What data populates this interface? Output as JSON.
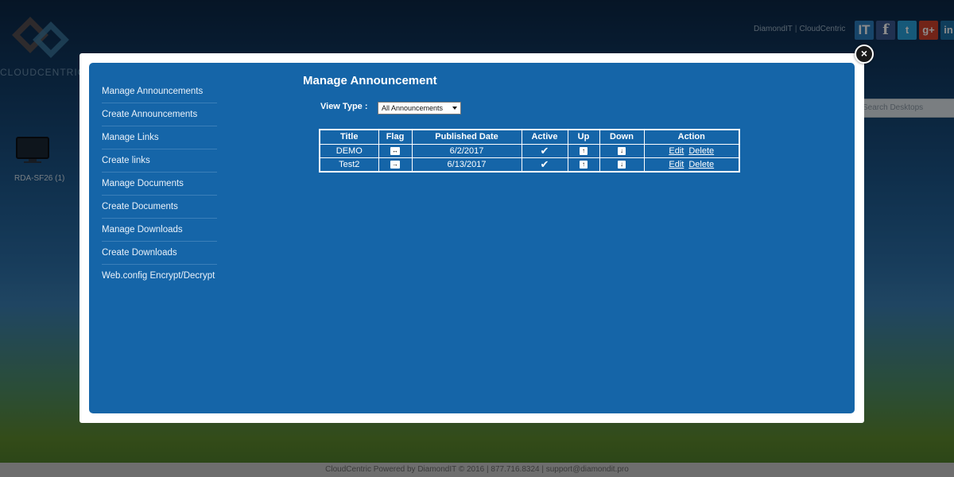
{
  "background": {
    "logo_text": "CLOUDCENTRIC",
    "header_links": [
      "DiamondIT",
      "CloudCentric"
    ],
    "header_sep": "|",
    "social_icons": [
      {
        "name": "it-icon",
        "glyph": "IT"
      },
      {
        "name": "facebook-icon",
        "glyph": "f"
      },
      {
        "name": "twitter-icon",
        "glyph": "t"
      },
      {
        "name": "google-plus-icon",
        "glyph": "g+"
      },
      {
        "name": "linkedin-icon",
        "glyph": "in"
      }
    ],
    "search_placeholder": "Search Desktops",
    "desktop_label": "RDA-SF26 (1)",
    "footer": "CloudCentric Powered by DiamondIT © 2016 | 877.716.8324 | support@diamondit.pro"
  },
  "modal": {
    "close_glyph": "×",
    "sidebar": {
      "items": [
        "Manage Announcements",
        "Create Announcements",
        "Manage Links",
        "Create links",
        "Manage Documents",
        "Create Documents",
        "Manage Downloads",
        "Create Downloads",
        "Web.config Encrypt/Decrypt"
      ]
    },
    "title": "Manage Announcement",
    "view_type_label": "View Type :",
    "view_type_value": "All Announcements",
    "table": {
      "headers": [
        "Title",
        "Flag",
        "Published Date",
        "Active",
        "Up",
        "Down",
        "Action"
      ],
      "rows": [
        {
          "title": "DEMO",
          "flag": "↔",
          "date": "6/2/2017",
          "active": "✔",
          "up": "↑",
          "down": "↓",
          "edit": "Edit",
          "delete": "Delete"
        },
        {
          "title": "Test2",
          "flag": "→",
          "date": "6/13/2017",
          "active": "✔",
          "up": "↑",
          "down": "↓",
          "edit": "Edit",
          "delete": "Delete"
        }
      ]
    }
  }
}
